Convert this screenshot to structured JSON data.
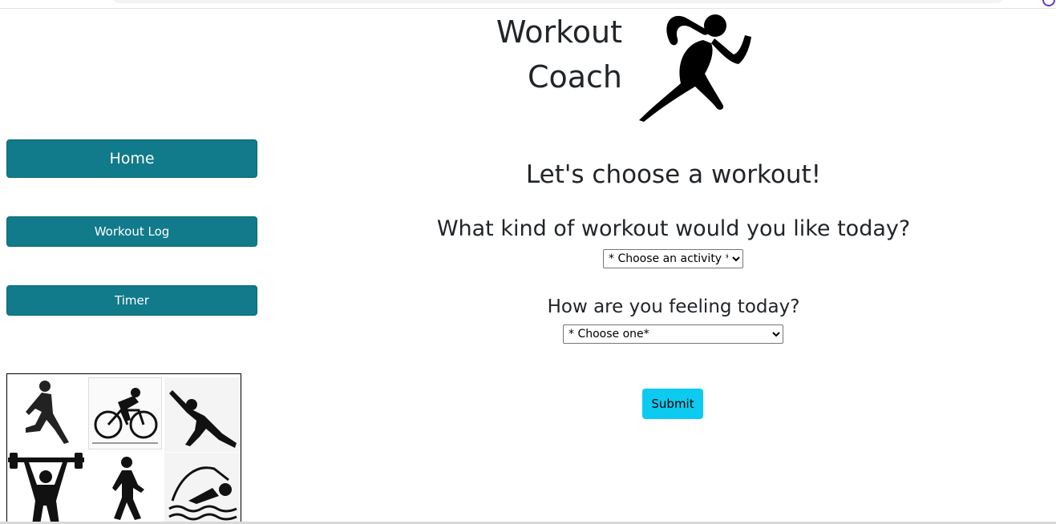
{
  "header": {
    "title_line1": "Workout",
    "title_line2": "Coach",
    "logo_icon": "runner-icon"
  },
  "sidebar": {
    "items": [
      {
        "label": "Home"
      },
      {
        "label": "Workout Log"
      },
      {
        "label": "Timer"
      }
    ],
    "collage_icons": [
      "running-woman-icon",
      "cyclist-icon",
      "yoga-stretch-icon",
      "weightlifter-icon",
      "walking-person-icon",
      "swimmer-icon"
    ]
  },
  "main": {
    "heading": "Let's choose a workout!",
    "activity_question": "What kind of workout would you like today?",
    "activity_select_value": "* Choose an activity *",
    "feeling_question": "How are you feeling today?",
    "feeling_select_value": "* Choose one*",
    "submit_label": "Submit"
  },
  "colors": {
    "nav_button": "#117a8b",
    "submit_button": "#0dcaf0",
    "text": "#212529"
  }
}
